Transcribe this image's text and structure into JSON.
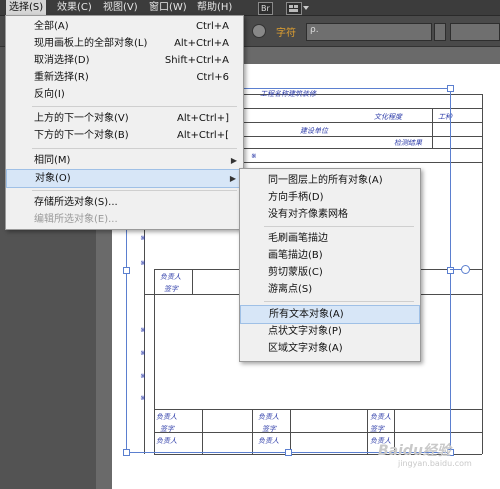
{
  "menubar": {
    "items": [
      "选择(S)",
      "效果(C)",
      "视图(V)",
      "窗口(W)",
      "帮助(H)"
    ],
    "badge": "Br"
  },
  "controlbar": {
    "char_label": "字符",
    "search_placeholder": "ρ."
  },
  "select_menu": {
    "items": [
      {
        "label": "全部(A)",
        "shortcut": "Ctrl+A"
      },
      {
        "label": "现用画板上的全部对象(L)",
        "shortcut": "Alt+Ctrl+A"
      },
      {
        "label": "取消选择(D)",
        "shortcut": "Shift+Ctrl+A"
      },
      {
        "label": "重新选择(R)",
        "shortcut": "Ctrl+6"
      },
      {
        "label": "反向(I)",
        "shortcut": ""
      },
      {
        "label": "上方的下一个对象(V)",
        "shortcut": "Alt+Ctrl+]"
      },
      {
        "label": "下方的下一个对象(B)",
        "shortcut": "Alt+Ctrl+["
      },
      {
        "label": "相同(M)",
        "shortcut": ""
      },
      {
        "label": "对象(O)",
        "shortcut": ""
      },
      {
        "label": "存储所选对象(S)...",
        "shortcut": ""
      },
      {
        "label": "编辑所选对象(E)...",
        "shortcut": ""
      }
    ]
  },
  "object_submenu": {
    "items": [
      "同一图层上的所有对象(A)",
      "方向手柄(D)",
      "没有对齐像素网格",
      "毛刷画笔描边",
      "画笔描边(B)",
      "剪切蒙版(C)",
      "游离点(S)",
      "所有文本对象(A)",
      "点状文字对象(P)",
      "区域文字对象(A)"
    ]
  },
  "document": {
    "title_line": "工程名称建筑装修",
    "labels": [
      "文化程度",
      "工种",
      "建设单位",
      "检测结果",
      "负责人",
      "签字"
    ]
  },
  "watermark": "Baidu经验",
  "watermark_url": "jingyan.baidu.com"
}
